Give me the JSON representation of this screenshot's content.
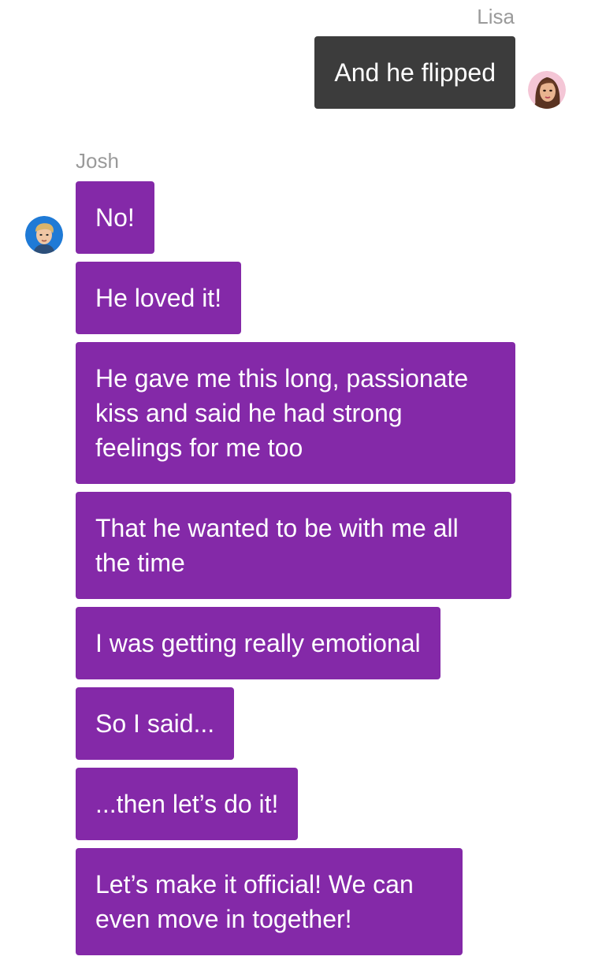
{
  "conversation": {
    "lisa": {
      "name": "Lisa",
      "avatar_icon": "lisa-avatar-icon",
      "messages": [
        "And he flipped"
      ],
      "bubble_color": "#3c3c3c"
    },
    "josh": {
      "name": "Josh",
      "avatar_icon": "josh-avatar-icon",
      "bubble_color": "#8429a8",
      "messages": [
        "No!",
        "He loved it!",
        "He gave me this long, passionate kiss and said he had strong feelings for me too",
        "That he wanted to be with me all the time",
        "I was getting really emotional",
        "So I said...",
        "...then let’s do it!",
        "Let’s make it official! We can even move in together!"
      ]
    }
  }
}
